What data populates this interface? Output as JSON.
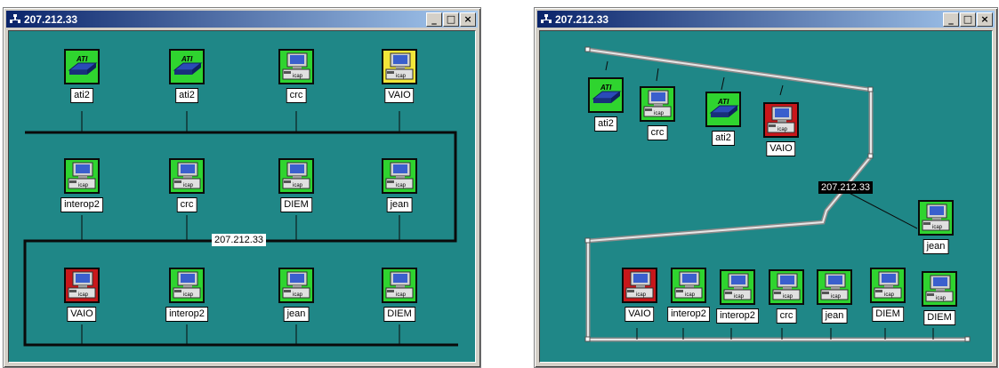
{
  "windows": [
    {
      "title": "207.212.33",
      "network_label": "207.212.33",
      "nodes": [
        {
          "label": "ati2",
          "kind": "switch",
          "status": "green"
        },
        {
          "label": "ati2",
          "kind": "switch",
          "status": "green"
        },
        {
          "label": "crc",
          "kind": "computer",
          "status": "green"
        },
        {
          "label": "VAIO",
          "kind": "computer",
          "status": "yellow"
        },
        {
          "label": "interop2",
          "kind": "computer",
          "status": "green"
        },
        {
          "label": "crc",
          "kind": "computer",
          "status": "green"
        },
        {
          "label": "DIEM",
          "kind": "computer",
          "status": "green"
        },
        {
          "label": "jean",
          "kind": "computer",
          "status": "green"
        },
        {
          "label": "VAIO",
          "kind": "computer",
          "status": "red"
        },
        {
          "label": "interop2",
          "kind": "computer",
          "status": "green"
        },
        {
          "label": "jean",
          "kind": "computer",
          "status": "green"
        },
        {
          "label": "DIEM",
          "kind": "computer",
          "status": "green"
        }
      ]
    },
    {
      "title": "207.212.33",
      "network_label": "207.212.33",
      "nodes": [
        {
          "label": "ati2",
          "kind": "switch",
          "status": "green"
        },
        {
          "label": "crc",
          "kind": "computer",
          "status": "green"
        },
        {
          "label": "ati2",
          "kind": "switch",
          "status": "green"
        },
        {
          "label": "VAIO",
          "kind": "computer",
          "status": "red"
        },
        {
          "label": "jean",
          "kind": "computer",
          "status": "green"
        },
        {
          "label": "VAIO",
          "kind": "computer",
          "status": "red"
        },
        {
          "label": "interop2",
          "kind": "computer",
          "status": "green"
        },
        {
          "label": "interop2",
          "kind": "computer",
          "status": "green"
        },
        {
          "label": "crc",
          "kind": "computer",
          "status": "green"
        },
        {
          "label": "jean",
          "kind": "computer",
          "status": "green"
        },
        {
          "label": "DIEM",
          "kind": "computer",
          "status": "green"
        },
        {
          "label": "DIEM",
          "kind": "computer",
          "status": "green"
        }
      ]
    }
  ],
  "window_buttons": {
    "minimize": "_",
    "maximize": "□",
    "close": "×"
  },
  "status_colors": {
    "green": "#2fd42f",
    "yellow": "#f2e63a",
    "red": "#c8171a"
  },
  "icon_badge_text": "icap"
}
